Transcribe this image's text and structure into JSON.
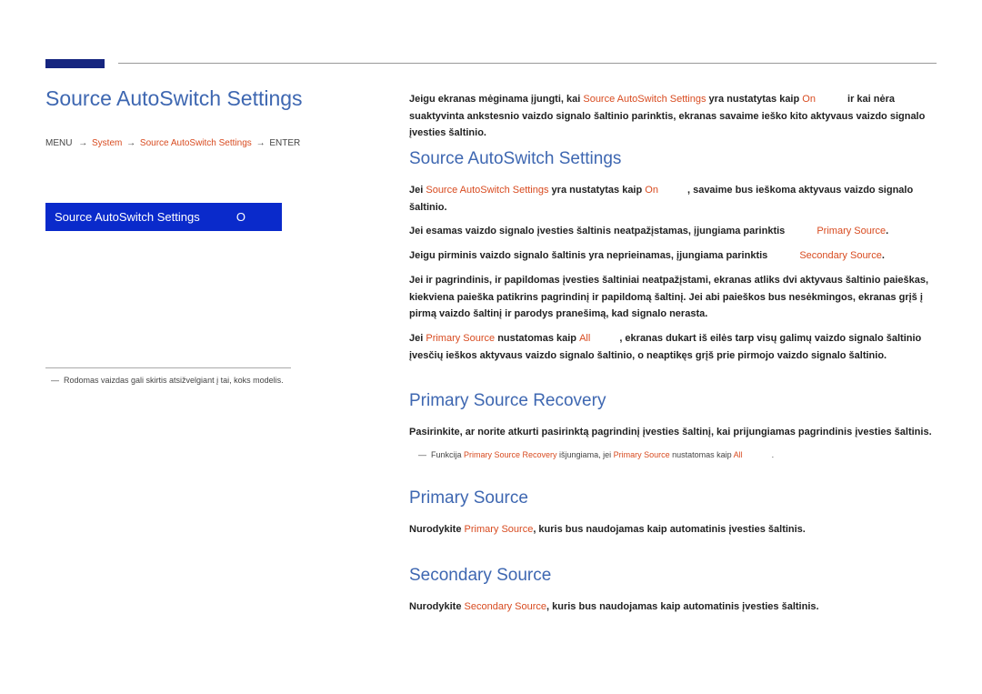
{
  "pageTitle": "Source AutoSwitch Settings",
  "breadcrumb": {
    "menu": "MENU",
    "system": "System",
    "item": "Source AutoSwitch Settings",
    "enter": "ENTER"
  },
  "menuBox": {
    "label": "Source AutoSwitch Settings",
    "action": "O"
  },
  "leftFootnote": "Rodomas vaizdas gali skirtis atsižvelgiant į tai, koks modelis.",
  "section1": {
    "title": "Source AutoSwitch Settings",
    "p1a": "Jeigu ekranas mėginama įjungti, kai ",
    "p1_hl1": "Source AutoSwitch Settings",
    "p1b": " yra nustatytas kaip ",
    "p1_hl2": "On",
    "p1c": " ir kai nėra suaktyvinta ankstesnio vaizdo signalo šaltinio parinktis, ekranas savaime ieško kito aktyvaus vaizdo signalo įvesties šaltinio.",
    "p2a": "Jei ",
    "p2_hl1": "Source AutoSwitch Settings",
    "p2b": " yra nustatytas kaip ",
    "p2_hl2": "On",
    "p2c": ", savaime bus ieškoma aktyvaus vaizdo signalo šaltinio.",
    "p3a": "Jei esamas vaizdo signalo įvesties šaltinis neatpažįstamas, įjungiama parinktis ",
    "p3_hl": "Primary Source",
    "p4a": "Jeigu pirminis vaizdo signalo šaltinis yra neprieinamas, įjungiama parinktis ",
    "p4_hl": "Secondary Source",
    "p5": "Jei ir pagrindinis, ir papildomas įvesties šaltiniai neatpažįstami, ekranas atliks dvi aktyvaus šaltinio paieškas, kiekviena paieška patikrins pagrindinį ir papildomą šaltinį. Jei abi paieškos bus nesėkmingos, ekranas grįš į pirmą vaizdo šaltinį ir parodys pranešimą, kad signalo nerasta.",
    "p6a": "Jei ",
    "p6_hl1": "Primary Source",
    "p6b": " nustatomas kaip ",
    "p6_hl2": "All",
    "p6c": ", ekranas dukart iš eilės tarp visų galimų vaizdo signalo šaltinio įvesčių ieškos aktyvaus vaizdo signalo šaltinio, o neaptikęs grįš prie pirmojo vaizdo signalo šaltinio."
  },
  "section2": {
    "title": "Primary Source Recovery",
    "p1": "Pasirinkite, ar norite atkurti pasirinktą pagrindinį įvesties šaltinį, kai prijungiamas pagrindinis įvesties šaltinis.",
    "noteA": "Funkcija ",
    "note_hl1": "Primary Source Recovery",
    "noteB": " išjungiama, jei ",
    "note_hl2": "Primary Source",
    "noteC": " nustatomas kaip ",
    "note_hl3": "All",
    "noteD": "."
  },
  "section3": {
    "title": "Primary Source",
    "pa": "Nurodykite ",
    "hl": "Primary Source",
    "pb": ", kuris bus naudojamas kaip automatinis įvesties šaltinis."
  },
  "section4": {
    "title": "Secondary Source",
    "pa": "Nurodykite ",
    "hl": "Secondary Source",
    "pb": ", kuris bus naudojamas kaip automatinis įvesties šaltinis."
  }
}
